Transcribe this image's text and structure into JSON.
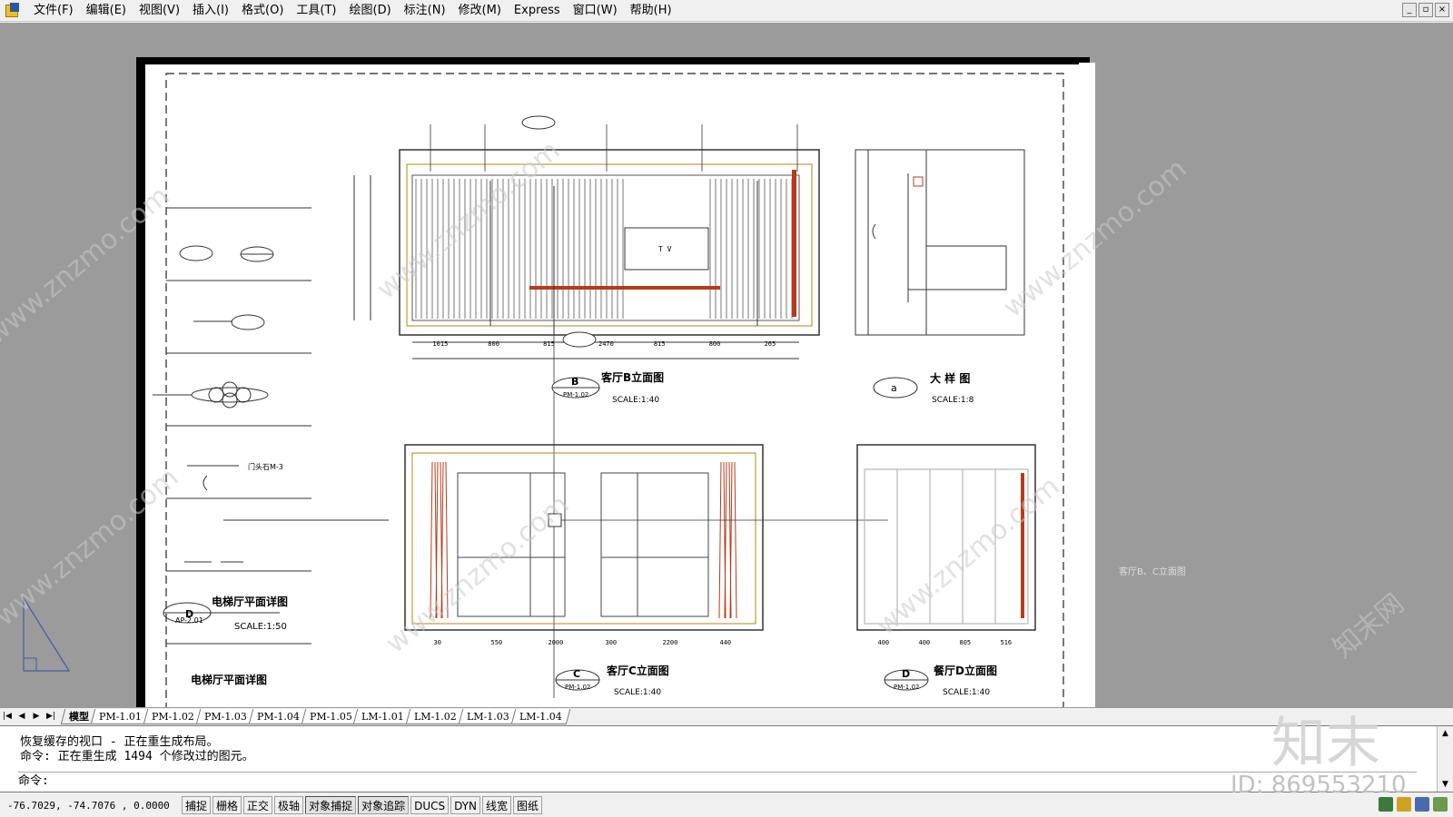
{
  "menubar": {
    "items": [
      "文件(F)",
      "编辑(E)",
      "视图(V)",
      "插入(I)",
      "格式(O)",
      "工具(T)",
      "绘图(D)",
      "标注(N)",
      "修改(M)",
      "Express",
      "窗口(W)",
      "帮助(H)"
    ],
    "window_controls": [
      "_",
      "▫",
      "×"
    ]
  },
  "drawing": {
    "views": {
      "b": {
        "title": "客厅B立面图",
        "tag_letter": "B",
        "tag_ref": "PM-1.02",
        "scale": "SCALE:1:40"
      },
      "a": {
        "title": "大 样 图",
        "tag_letter": "a",
        "scale": "SCALE:1:8"
      },
      "c": {
        "title": "客厅C立面图",
        "tag_letter": "C",
        "tag_ref": "PM-1.02",
        "scale": "SCALE:1:40"
      },
      "d": {
        "title": "餐厅D立面图",
        "tag_letter": "D",
        "tag_ref": "PM-1.02",
        "scale": "SCALE:1:40"
      }
    },
    "legend": {
      "title": "电梯厅平面详图",
      "tag_letter": "D",
      "tag_ref": "AP-2.01",
      "scale": "SCALE:1:50",
      "bottom_title": "电梯厅平面详图",
      "door_label": "门头石M-3"
    },
    "b_dims": [
      "1015",
      "800",
      "815",
      "2470",
      "815",
      "800",
      "265"
    ],
    "c_dims": [
      "30",
      "550",
      "2000",
      "300",
      "2200",
      "440"
    ],
    "d_dims": [
      "400",
      "400",
      "805",
      "516"
    ],
    "tv_label": "T V",
    "side_label": "客厅B、C立面图"
  },
  "layout_tabs": [
    "模型",
    "PM-1.01",
    "PM-1.02",
    "PM-1.03",
    "PM-1.04",
    "PM-1.05",
    "LM-1.01",
    "LM-1.02",
    "LM-1.03",
    "LM-1.04"
  ],
  "command": {
    "lines": [
      "恢复缓存的视口 - 正在重生成布局。",
      "命令: 正在重生成 1494 个修改过的图元。"
    ],
    "prompt": "命令:"
  },
  "status": {
    "coords": "-76.7029, -74.7076 , 0.0000",
    "buttons": [
      "捕捉",
      "栅格",
      "正交",
      "极轴",
      "对象捕捉",
      "对象追踪",
      "DUCS",
      "DYN",
      "线宽",
      "图纸"
    ]
  },
  "watermark": {
    "brand": "知末",
    "id": "ID: 869553210",
    "site": "www.znzmo.com",
    "site_cn": "知末网"
  },
  "colors": {
    "paper": "#ffffff",
    "workspace": "#9b9b9b",
    "curtain": "#b83a1a",
    "trim": "#b8860b"
  }
}
